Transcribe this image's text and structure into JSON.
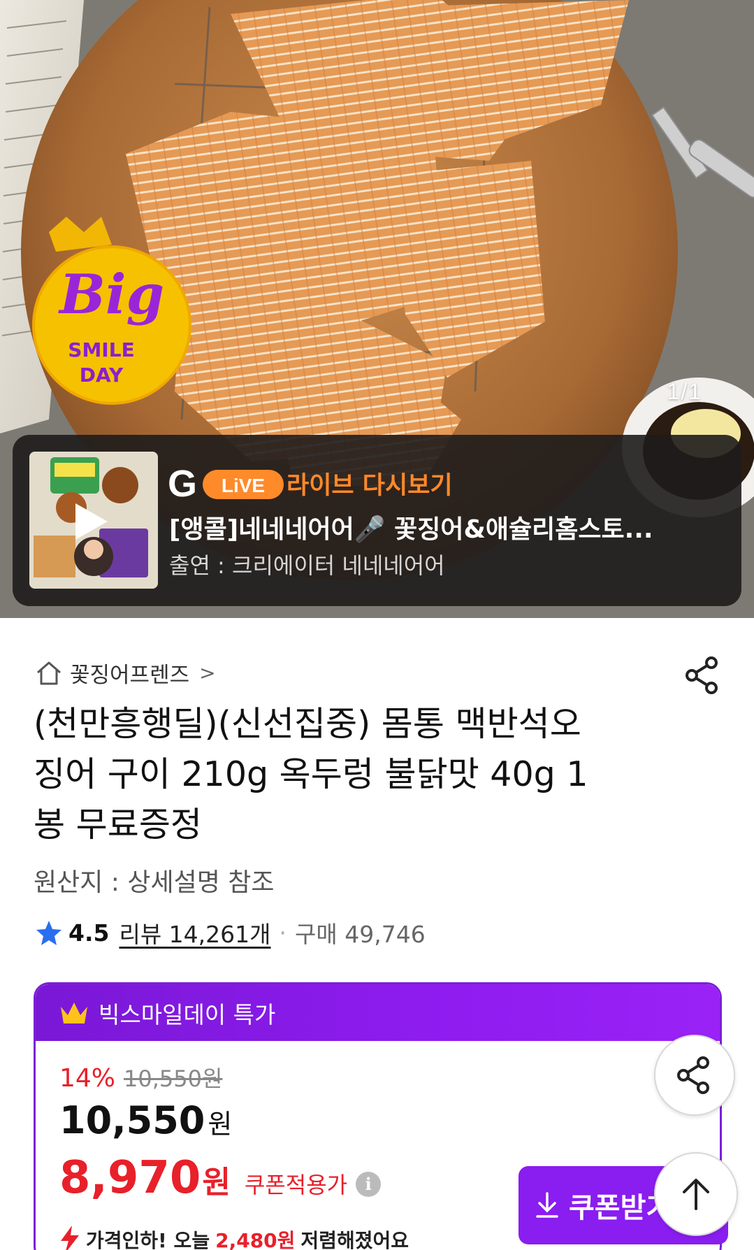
{
  "hero": {
    "page_indicator": "1/1",
    "badge": {
      "big": "Big",
      "line1": "SMILE",
      "line2": "DAY"
    }
  },
  "live": {
    "logo_g": "G",
    "logo_live": "LiVE",
    "replay_label": "라이브 다시보기",
    "title": "[앵콜]네네네어어🎤 꽃징어&애슐리홈스토...",
    "subtitle": "출연 : 크리에이터 네네네어어"
  },
  "breadcrumb": {
    "store": "꽃징어프렌즈",
    "chevron": ">"
  },
  "product": {
    "title": "(천만흥행딜)(신선집중) 몸통 맥반석오징어 구이 210g 옥두렁 불닭맛 40g 1봉 무료증정",
    "origin": "원산지 : 상세설명 참조",
    "rating": "4.5",
    "review": "리뷰 14,261개",
    "separator": "·",
    "purchase": "구매 49,746"
  },
  "deal": {
    "header": "빅스마일데이 특가",
    "discount_pct": "14%",
    "original_price": "10,550원",
    "price": "10,550",
    "price_unit": "원",
    "coupon_price": "8,970",
    "coupon_unit": "원",
    "coupon_label": "쿠폰적용가",
    "info": "i",
    "price_cut_prefix": "가격인하! 오늘 ",
    "price_cut_amount": "2,480원",
    "price_cut_suffix": " 저렴해졌어요",
    "coupon_button": "쿠폰받기"
  },
  "colors": {
    "accent_purple": "#8a1df0",
    "sale_red": "#e8202a",
    "live_orange": "#ff8a2a"
  },
  "icons": [
    "home-icon",
    "share-icon",
    "star-icon",
    "crown-icon",
    "info-icon",
    "download-icon",
    "arrow-up-icon",
    "play-icon",
    "lightning-icon"
  ]
}
